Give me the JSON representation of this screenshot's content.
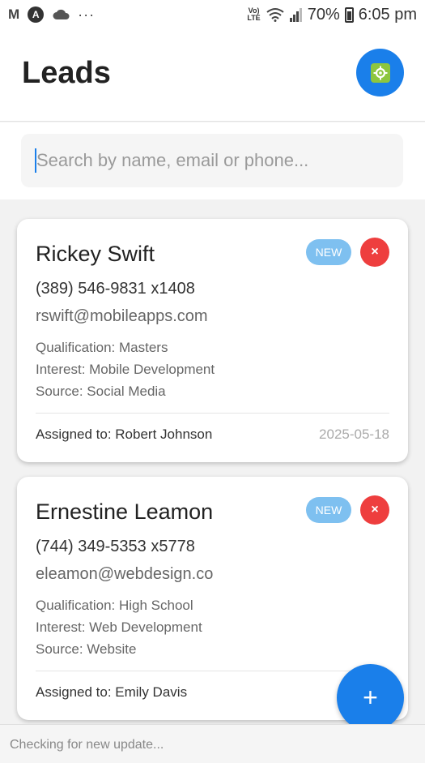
{
  "status_bar": {
    "left_icons": [
      "gmail-icon",
      "a-circle-icon",
      "cloud-icon",
      "more-dots-icon"
    ],
    "volte_label": "Vo)\nLTE",
    "battery": "70%",
    "time": "6:05 pm"
  },
  "header": {
    "title": "Leads",
    "settings_icon": "settings-gear-icon",
    "accent_color": "#1a7fea"
  },
  "search": {
    "placeholder": "Search by name, email or phone...",
    "value": ""
  },
  "leads": [
    {
      "name": "Rickey Swift",
      "status": "NEW",
      "phone": "(389) 546-9831 x1408",
      "email": "rswift@mobileapps.com",
      "qualification": "Qualification: Masters",
      "interest": "Interest: Mobile Development",
      "source": "Source: Social Media",
      "assigned": "Assigned to: Robert Johnson",
      "date": "2025-05-18",
      "delete_label": "×"
    },
    {
      "name": "Ernestine Leamon",
      "status": "NEW",
      "phone": "(744) 349-5353 x5778",
      "email": "eleamon@webdesign.co",
      "qualification": "Qualification: High School",
      "interest": "Interest: Web Development",
      "source": "Source: Website",
      "assigned": "Assigned to: Emily Davis",
      "date": "202",
      "delete_label": "×"
    }
  ],
  "fab": {
    "label": "+"
  },
  "footer": {
    "status_text": "Checking for new update..."
  },
  "colors": {
    "badge": "#7ec0f0",
    "delete": "#ee3e3e",
    "primary": "#1a7fea"
  }
}
